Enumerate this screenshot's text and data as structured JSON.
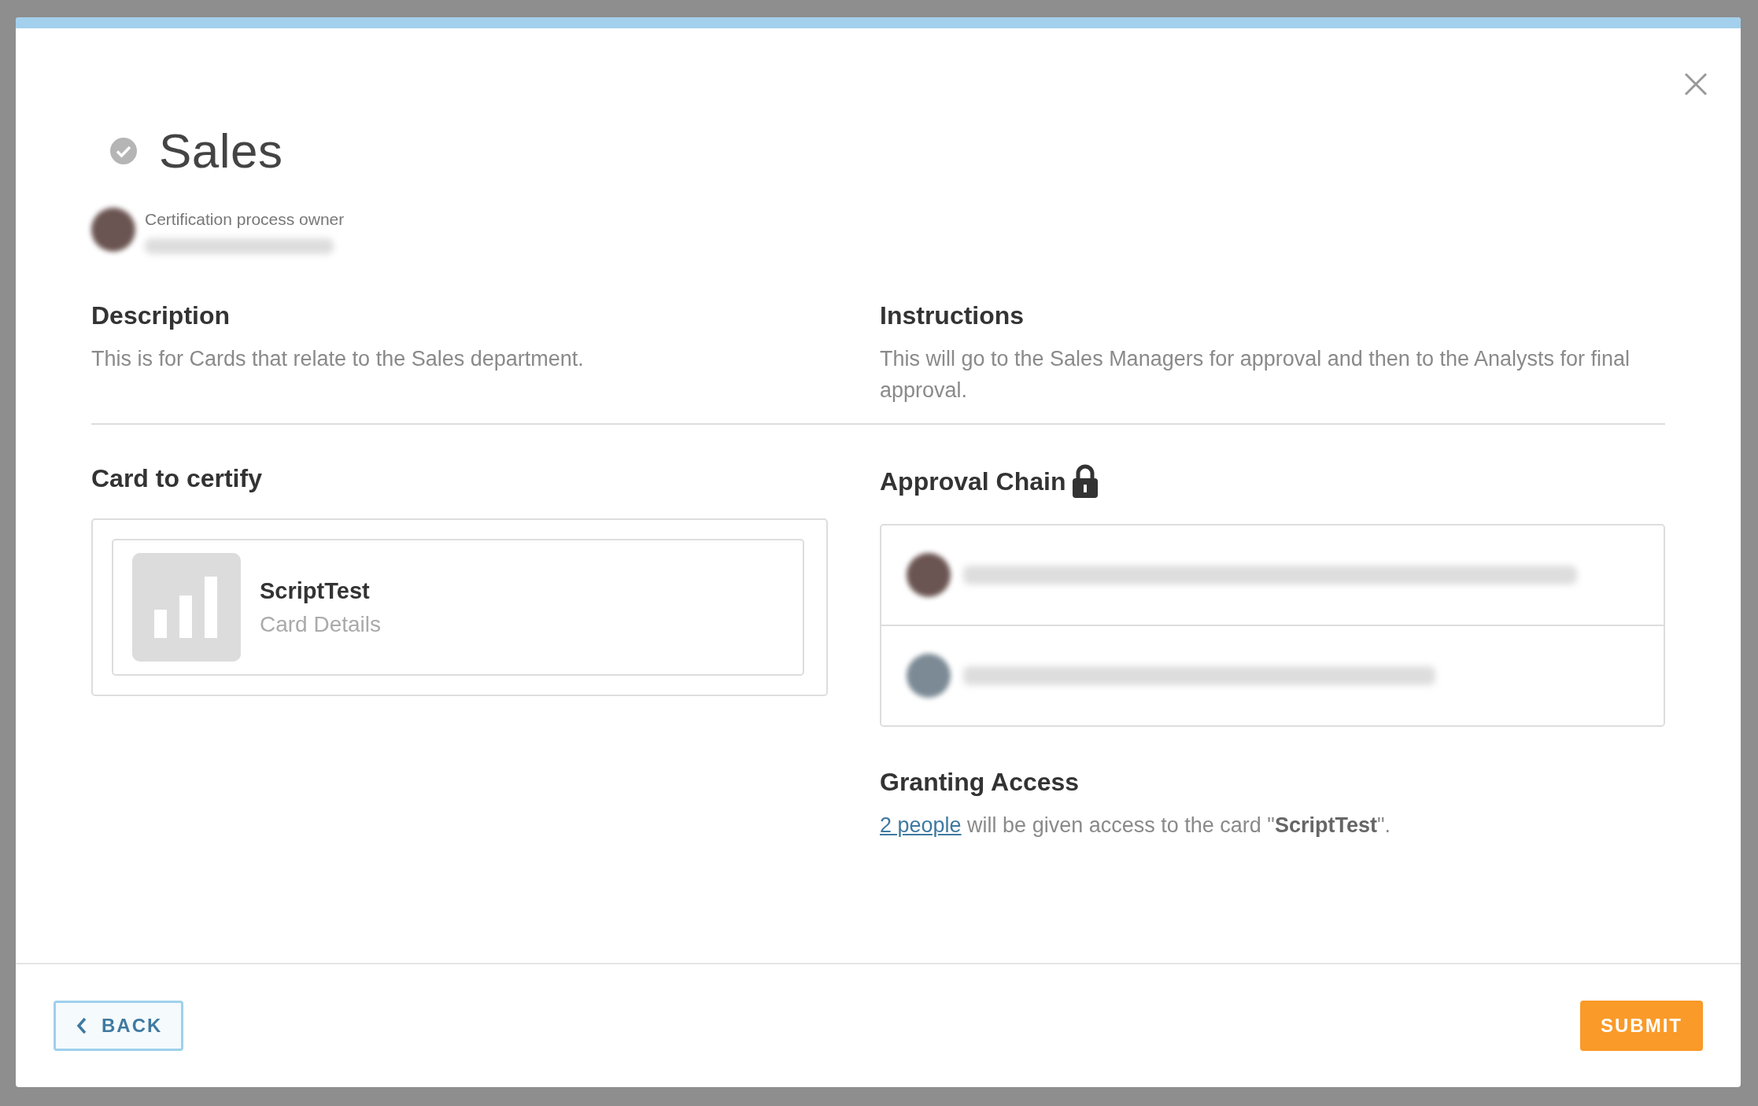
{
  "dialog": {
    "title": "Sales",
    "verified": true,
    "owner_label": "Certification process owner",
    "owner_name_redacted": true,
    "description": {
      "heading": "Description",
      "text": "This is for Cards that relate to the Sales department."
    },
    "instructions": {
      "heading": "Instructions",
      "text": "This will go to the Sales Managers for approval and then to the Analysts for final approval."
    },
    "card_section": {
      "heading": "Card to certify",
      "card": {
        "name": "ScriptTest",
        "subtitle": "Card Details"
      }
    },
    "approval_chain": {
      "heading": "Approval Chain",
      "locked": true,
      "approvers": [
        {
          "redacted": true
        },
        {
          "redacted": true
        }
      ]
    },
    "granting_access": {
      "heading": "Granting Access",
      "link": "2 people",
      "text": " will be given access to the card \"**ScriptTest**\"."
    },
    "buttons": [
      {
        "kind": "back",
        "label": "BACK"
      },
      {
        "kind": "submit",
        "label": "SUBMIT"
      }
    ]
  }
}
